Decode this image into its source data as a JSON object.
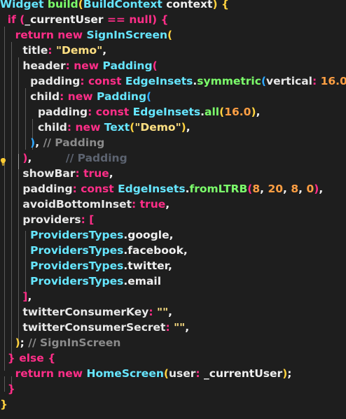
{
  "lines": [
    {
      "tokens": [
        {
          "t": "Widget ",
          "c": "type"
        },
        {
          "t": "build",
          "c": "fn"
        },
        {
          "t": "(",
          "c": "paren-y"
        },
        {
          "t": "BuildContext",
          "c": "type"
        },
        {
          "t": " context",
          "c": "plain"
        },
        {
          "t": ")",
          "c": "paren-y"
        },
        {
          "t": " {",
          "c": "paren-y"
        }
      ]
    },
    {
      "tokens": [
        {
          "t": "  if ",
          "c": "kw"
        },
        {
          "t": "(",
          "c": "paren-p"
        },
        {
          "t": "_currentUser ",
          "c": "plain"
        },
        {
          "t": "== ",
          "c": "kw"
        },
        {
          "t": "null",
          "c": "kw"
        },
        {
          "t": ")",
          "c": "paren-p"
        },
        {
          "t": " {",
          "c": "paren-p"
        }
      ]
    },
    {
      "tokens": [
        {
          "t": "    return new ",
          "c": "kw"
        },
        {
          "t": "SignInScreen",
          "c": "type"
        },
        {
          "t": "(",
          "c": "paren-y"
        }
      ]
    },
    {
      "tokens": [
        {
          "t": "      title",
          "c": "prop"
        },
        {
          "t": ": ",
          "c": "punc"
        },
        {
          "t": "\"Demo\"",
          "c": "str"
        },
        {
          "t": ",",
          "c": "plain"
        }
      ]
    },
    {
      "tokens": [
        {
          "t": "      header",
          "c": "prop"
        },
        {
          "t": ": ",
          "c": "punc"
        },
        {
          "t": "new ",
          "c": "kw"
        },
        {
          "t": "Padding",
          "c": "type"
        },
        {
          "t": "(",
          "c": "paren-p"
        }
      ]
    },
    {
      "tokens": [
        {
          "t": "        padding",
          "c": "prop"
        },
        {
          "t": ": ",
          "c": "punc"
        },
        {
          "t": "const ",
          "c": "kw"
        },
        {
          "t": "EdgeInsets",
          "c": "type"
        },
        {
          "t": ".",
          "c": "plain"
        },
        {
          "t": "symmetric",
          "c": "fn"
        },
        {
          "t": "(",
          "c": "paren-b"
        },
        {
          "t": "vertical",
          "c": "prop"
        },
        {
          "t": ": ",
          "c": "punc"
        },
        {
          "t": "16.0",
          "c": "num"
        },
        {
          "t": ")",
          "c": "paren-b"
        },
        {
          "t": ",",
          "c": "plain"
        }
      ]
    },
    {
      "tokens": [
        {
          "t": "        child",
          "c": "prop"
        },
        {
          "t": ": ",
          "c": "punc"
        },
        {
          "t": "new ",
          "c": "kw"
        },
        {
          "t": "Padding",
          "c": "type"
        },
        {
          "t": "(",
          "c": "paren-b"
        }
      ]
    },
    {
      "tokens": [
        {
          "t": "          padding",
          "c": "prop"
        },
        {
          "t": ": ",
          "c": "punc"
        },
        {
          "t": "const ",
          "c": "kw"
        },
        {
          "t": "EdgeInsets",
          "c": "type"
        },
        {
          "t": ".",
          "c": "plain"
        },
        {
          "t": "all",
          "c": "fn"
        },
        {
          "t": "(",
          "c": "paren-y"
        },
        {
          "t": "16.0",
          "c": "num"
        },
        {
          "t": ")",
          "c": "paren-y"
        },
        {
          "t": ",",
          "c": "plain"
        }
      ]
    },
    {
      "tokens": [
        {
          "t": "          child",
          "c": "prop"
        },
        {
          "t": ": ",
          "c": "punc"
        },
        {
          "t": "new ",
          "c": "kw"
        },
        {
          "t": "Text",
          "c": "type"
        },
        {
          "t": "(",
          "c": "paren-y"
        },
        {
          "t": "\"Demo\"",
          "c": "str"
        },
        {
          "t": ")",
          "c": "paren-y"
        },
        {
          "t": ",",
          "c": "plain"
        }
      ]
    },
    {
      "tokens": [
        {
          "t": "        )",
          "c": "paren-b"
        },
        {
          "t": ", ",
          "c": "plain"
        },
        {
          "t": "// Padding",
          "c": "comment"
        }
      ]
    },
    {
      "tokens": [
        {
          "t": "      )",
          "c": "paren-p"
        },
        {
          "t": ",",
          "c": "plain"
        },
        {
          "t": "         // Padding",
          "c": "ghost"
        }
      ]
    },
    {
      "tokens": [
        {
          "t": "      showBar",
          "c": "prop"
        },
        {
          "t": ": ",
          "c": "punc"
        },
        {
          "t": "true",
          "c": "kw"
        },
        {
          "t": ",",
          "c": "plain"
        }
      ]
    },
    {
      "tokens": [
        {
          "t": "      padding",
          "c": "prop"
        },
        {
          "t": ": ",
          "c": "punc"
        },
        {
          "t": "const ",
          "c": "kw"
        },
        {
          "t": "EdgeInsets",
          "c": "type"
        },
        {
          "t": ".",
          "c": "plain"
        },
        {
          "t": "fromLTRB",
          "c": "fn"
        },
        {
          "t": "(",
          "c": "paren-p"
        },
        {
          "t": "8",
          "c": "num"
        },
        {
          "t": ", ",
          "c": "plain"
        },
        {
          "t": "20",
          "c": "num"
        },
        {
          "t": ", ",
          "c": "plain"
        },
        {
          "t": "8",
          "c": "num"
        },
        {
          "t": ", ",
          "c": "plain"
        },
        {
          "t": "0",
          "c": "num"
        },
        {
          "t": ")",
          "c": "paren-p"
        },
        {
          "t": ",",
          "c": "plain"
        }
      ]
    },
    {
      "tokens": [
        {
          "t": "      avoidBottomInset",
          "c": "prop"
        },
        {
          "t": ": ",
          "c": "punc"
        },
        {
          "t": "true",
          "c": "kw"
        },
        {
          "t": ",",
          "c": "plain"
        }
      ]
    },
    {
      "tokens": [
        {
          "t": "      providers",
          "c": "prop"
        },
        {
          "t": ": ",
          "c": "punc"
        },
        {
          "t": "[",
          "c": "paren-p"
        }
      ]
    },
    {
      "tokens": [
        {
          "t": "        ProvidersTypes",
          "c": "type"
        },
        {
          "t": ".google,",
          "c": "plain"
        }
      ]
    },
    {
      "tokens": [
        {
          "t": "        ProvidersTypes",
          "c": "type"
        },
        {
          "t": ".facebook,",
          "c": "plain"
        }
      ]
    },
    {
      "tokens": [
        {
          "t": "        ProvidersTypes",
          "c": "type"
        },
        {
          "t": ".twitter,",
          "c": "plain"
        }
      ]
    },
    {
      "tokens": [
        {
          "t": "        ProvidersTypes",
          "c": "type"
        },
        {
          "t": ".email",
          "c": "plain"
        }
      ]
    },
    {
      "tokens": [
        {
          "t": "      ]",
          "c": "paren-p"
        },
        {
          "t": ",",
          "c": "plain"
        }
      ]
    },
    {
      "tokens": [
        {
          "t": "      twitterConsumerKey",
          "c": "prop"
        },
        {
          "t": ": ",
          "c": "punc"
        },
        {
          "t": "\"\"",
          "c": "str"
        },
        {
          "t": ",",
          "c": "plain"
        }
      ]
    },
    {
      "tokens": [
        {
          "t": "      twitterConsumerSecret",
          "c": "prop"
        },
        {
          "t": ": ",
          "c": "punc"
        },
        {
          "t": "\"\"",
          "c": "str"
        },
        {
          "t": ",",
          "c": "plain"
        }
      ]
    },
    {
      "tokens": [
        {
          "t": "    )",
          "c": "paren-y"
        },
        {
          "t": "; ",
          "c": "plain"
        },
        {
          "t": "// SignInScreen",
          "c": "comment"
        }
      ]
    },
    {
      "tokens": [
        {
          "t": "  } ",
          "c": "paren-p"
        },
        {
          "t": "else ",
          "c": "kw"
        },
        {
          "t": "{",
          "c": "paren-p"
        }
      ]
    },
    {
      "tokens": [
        {
          "t": "    return new ",
          "c": "kw"
        },
        {
          "t": "HomeScreen",
          "c": "type"
        },
        {
          "t": "(",
          "c": "paren-y"
        },
        {
          "t": "user",
          "c": "prop"
        },
        {
          "t": ": ",
          "c": "punc"
        },
        {
          "t": "_currentUser",
          "c": "plain"
        },
        {
          "t": ")",
          "c": "paren-y"
        },
        {
          "t": ";",
          "c": "plain"
        }
      ]
    },
    {
      "tokens": [
        {
          "t": "  }",
          "c": "paren-p"
        }
      ]
    },
    {
      "tokens": [
        {
          "t": "}",
          "c": "paren-y"
        }
      ]
    }
  ],
  "colors": {
    "background": "#1e1e1e",
    "keyword": "#ff2e88",
    "type": "#66e6ff",
    "function": "#7cff6b",
    "string": "#ffe082",
    "number": "#ff9f43",
    "comment": "#8b8b8b"
  },
  "icons": {
    "gutter": "lightbulb-icon"
  }
}
